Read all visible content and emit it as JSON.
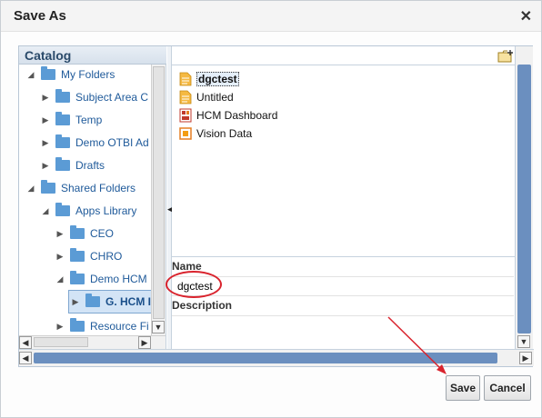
{
  "dialog": {
    "title": "Save As",
    "close_glyph": "✕"
  },
  "catalog": {
    "title": "Catalog",
    "items": [
      {
        "label": "My Folders",
        "twisty": "◢"
      },
      {
        "label": "Subject Area C",
        "twisty": "▶"
      },
      {
        "label": "Temp",
        "twisty": "▶"
      },
      {
        "label": "Demo OTBI Ad",
        "twisty": "▶"
      },
      {
        "label": "Drafts",
        "twisty": "▶"
      },
      {
        "label": "Shared Folders",
        "twisty": "◢"
      },
      {
        "label": "Apps Library",
        "twisty": "◢"
      },
      {
        "label": "CEO",
        "twisty": "▶"
      },
      {
        "label": "CHRO",
        "twisty": "▶"
      },
      {
        "label": "Demo HCM",
        "twisty": "◢"
      },
      {
        "label": "G. HCM I",
        "twisty": "▶"
      },
      {
        "label": "Resource Fi",
        "twisty": "▶"
      }
    ]
  },
  "files": [
    {
      "name": "dgctest",
      "icon": "document-icon"
    },
    {
      "name": "Untitled",
      "icon": "document-icon"
    },
    {
      "name": "HCM Dashboard",
      "icon": "dashboard-icon"
    },
    {
      "name": "Vision Data",
      "icon": "data-model-icon"
    }
  ],
  "form": {
    "name_label": "Name",
    "name_value": "dgctest",
    "description_label": "Description",
    "description_value": ""
  },
  "buttons": {
    "save": "Save",
    "cancel": "Cancel"
  },
  "colors": {
    "accent": "#6b8fbf",
    "folder": "#5b9bd5",
    "annotation": "#d9232d"
  }
}
